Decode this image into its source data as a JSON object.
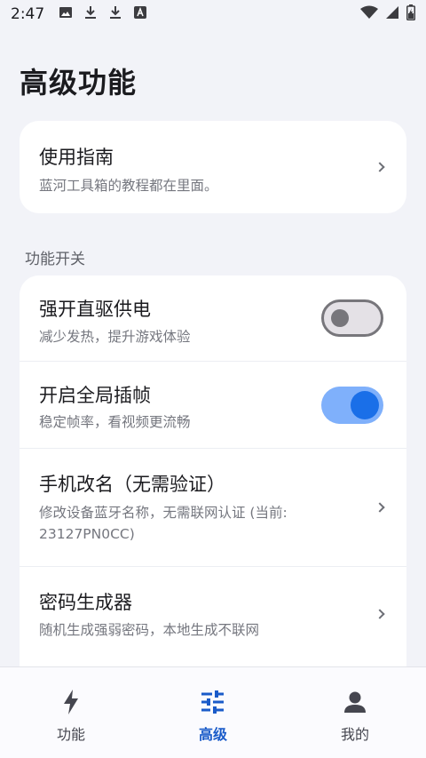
{
  "status": {
    "time": "2:47",
    "icons": [
      "image-icon",
      "download-icon",
      "download-icon",
      "font-icon"
    ],
    "right_icons": [
      "wifi-icon",
      "signal-icon",
      "battery-icon"
    ]
  },
  "page": {
    "title": "高级功能"
  },
  "guide": {
    "title": "使用指南",
    "subtitle": "蓝河工具箱的教程都在里面。"
  },
  "section": {
    "label": "功能开关"
  },
  "features": [
    {
      "title": "强开直驱供电",
      "subtitle": "减少发热，提升游戏体验",
      "control": "switch",
      "on": false
    },
    {
      "title": "开启全局插帧",
      "subtitle": "稳定帧率，看视频更流畅",
      "control": "switch",
      "on": true
    },
    {
      "title": "手机改名（无需验证）",
      "subtitle": "修改设备蓝牙名称，无需联网认证 (当前: 23127PN0CC)",
      "control": "chevron"
    },
    {
      "title": "密码生成器",
      "subtitle": "随机生成强弱密码，本地生成不联网",
      "control": "chevron"
    }
  ],
  "nav": [
    {
      "label": "功能",
      "icon": "bolt-icon",
      "active": false
    },
    {
      "label": "高级",
      "icon": "tune-icon",
      "active": true
    },
    {
      "label": "我的",
      "icon": "person-icon",
      "active": false
    }
  ],
  "colors": {
    "accent": "#1a5bc9",
    "switch_on": "#1a6fe8",
    "switch_on_track": "#7fb0fb",
    "background": "#f2f3f8"
  }
}
